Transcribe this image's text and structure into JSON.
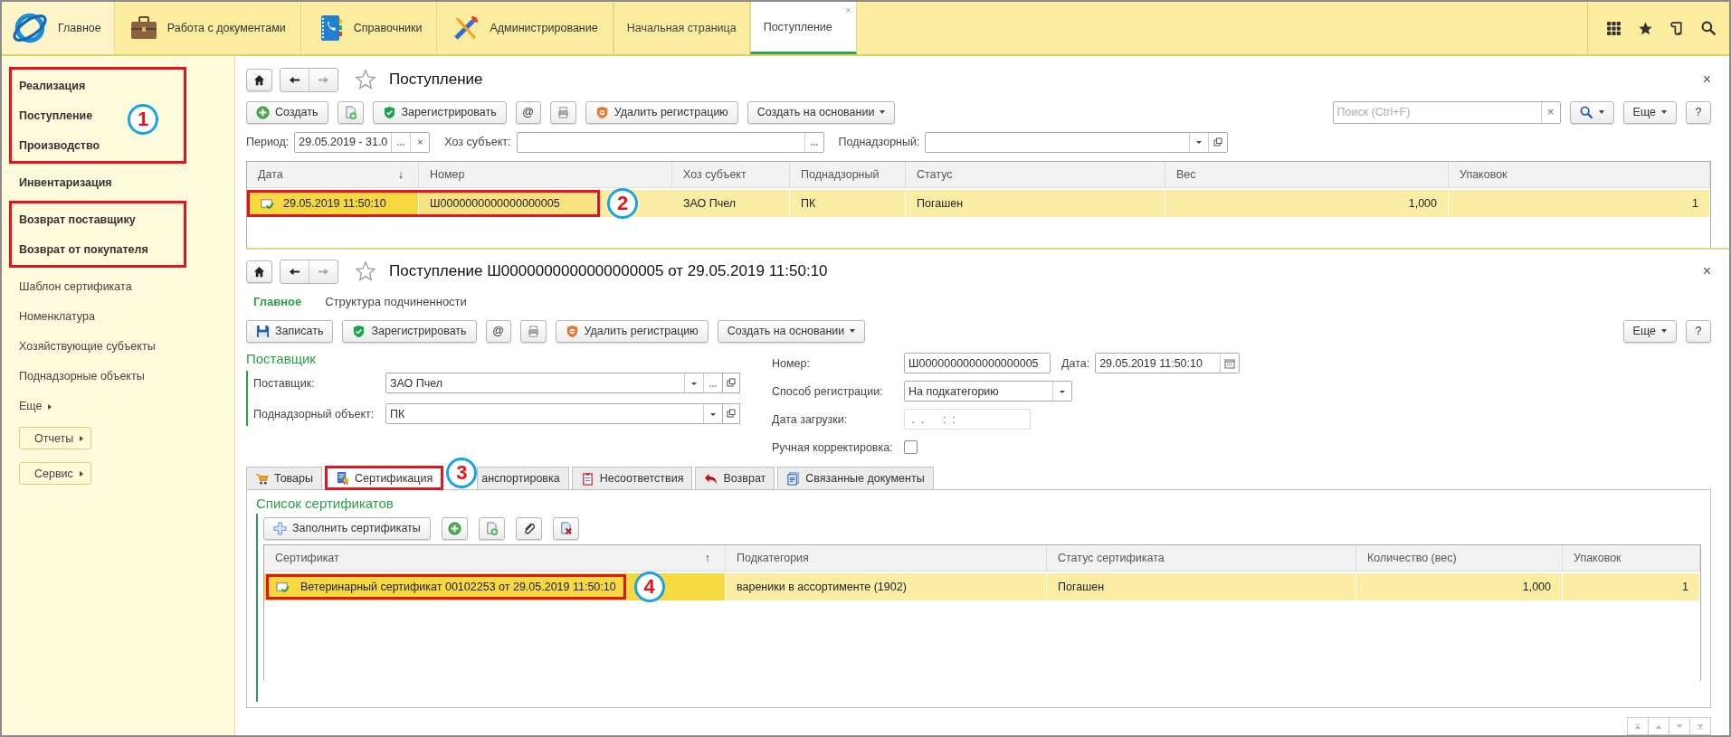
{
  "top_nav": {
    "sections": [
      {
        "label": "Главное",
        "kind": "logo",
        "selected": true
      },
      {
        "label": "Работа с документами",
        "kind": "briefcase",
        "selected": false
      },
      {
        "label": "Справочники",
        "kind": "book",
        "selected": false
      },
      {
        "label": "Администрирование",
        "kind": "tools",
        "selected": false
      }
    ],
    "open_tabs": [
      {
        "label": "Начальная страница",
        "selected": false,
        "closable": false
      },
      {
        "label": "Поступление",
        "selected": true,
        "closable": true
      }
    ],
    "close_glyph": "×"
  },
  "sidebar": {
    "groups": [
      {
        "outlined": true,
        "callout": "1",
        "items": [
          {
            "label": "Реализация",
            "kind": "section"
          },
          {
            "label": "Поступление",
            "kind": "section"
          },
          {
            "label": "Производство",
            "kind": "section"
          }
        ]
      },
      {
        "items": [
          {
            "label": "Инвентаризация",
            "kind": "section"
          }
        ]
      },
      {
        "outlined": true,
        "items": [
          {
            "label": "Возврат поставщику",
            "kind": "section"
          },
          {
            "label": "Возврат от покупателя",
            "kind": "section"
          }
        ]
      },
      {
        "items": [
          {
            "label": "Шаблон сертификата",
            "kind": "link"
          },
          {
            "label": "Номенклатура",
            "kind": "link"
          },
          {
            "label": "Хозяйствующие субъекты",
            "kind": "link"
          },
          {
            "label": "Поднадзорные объекты",
            "kind": "link"
          },
          {
            "label": "Еще",
            "kind": "more"
          },
          {
            "label": "Отчеты",
            "kind": "button"
          },
          {
            "label": "Сервис",
            "kind": "button"
          }
        ]
      }
    ]
  },
  "list_form": {
    "title": "Поступление",
    "close": "×",
    "toolbar": [
      {
        "label": "Создать",
        "kind": "create"
      },
      {
        "kind": "copy"
      },
      {
        "label": "Зарегистрировать",
        "kind": "register"
      },
      {
        "label": "@",
        "kind": "text"
      },
      {
        "kind": "print"
      },
      {
        "label": "Удалить регистрацию",
        "kind": "unregister"
      },
      {
        "label": "Создать на основании",
        "kind": "dropdown"
      }
    ],
    "search": {
      "placeholder": "Поиск (Ctrl+F)",
      "clear": "×"
    },
    "more": "Еще",
    "help": "?",
    "filters": [
      {
        "label": "Период:",
        "value": "29.05.2019 - 31.0",
        "kind": "period",
        "clear": "×"
      },
      {
        "label": "Хоз субъект:",
        "kind": "choice"
      },
      {
        "label": "Поднадзорный:",
        "kind": "select"
      }
    ],
    "table": {
      "columns": [
        {
          "label": "Дата",
          "sort": "↓"
        },
        {
          "label": "Номер"
        },
        {
          "label": "Хоз субъект"
        },
        {
          "label": "Поднадзорный"
        },
        {
          "label": "Статус"
        },
        {
          "label": "Вес",
          "numeric": true
        },
        {
          "label": "Упаковок",
          "numeric": true
        }
      ],
      "rows": [
        {
          "selected": true,
          "callout": "2",
          "cells": [
            "29.05.2019 11:50:10",
            "Ш0000000000000000005",
            "ЗАО Пчел",
            "ПК",
            "Погашен",
            "1,000",
            "1"
          ]
        }
      ]
    }
  },
  "doc_form": {
    "title": "Поступление Ш0000000000000000005 от 29.05.2019 11:50:10",
    "close": "×",
    "nav": [
      {
        "label": "Главное",
        "selected": true
      },
      {
        "label": "Структура подчиненности",
        "selected": false
      }
    ],
    "toolbar": [
      {
        "label": "Записать",
        "kind": "save"
      },
      {
        "label": "Зарегистрировать",
        "kind": "register"
      },
      {
        "label": "@",
        "kind": "text"
      },
      {
        "kind": "print"
      },
      {
        "label": "Удалить регистрацию",
        "kind": "unregister"
      },
      {
        "label": "Создать на основании",
        "kind": "dropdown"
      }
    ],
    "more": "Еще",
    "help": "?",
    "supplier_group": {
      "title": "Поставщик",
      "fields": [
        {
          "label": "Поставщик:",
          "value": "ЗАО Пчел",
          "kind": "full"
        },
        {
          "label": "Поднадзорный объект:",
          "value": "ПК",
          "kind": "short"
        }
      ]
    },
    "number": {
      "label": "Номер:",
      "value": "Ш0000000000000000005"
    },
    "date": {
      "label": "Дата:",
      "value": "29.05.2019 11:50:10"
    },
    "method": {
      "label": "Способ регистрации:",
      "value": "На подкатегорию"
    },
    "load_date": {
      "label": "Дата загрузки:",
      "value": " .  .      :  :"
    },
    "manual": {
      "label": "Ручная корректировка:",
      "checked": false
    },
    "tabs": [
      {
        "label": "Товары",
        "kind": "cart",
        "selected": false
      },
      {
        "label": "Сертификация",
        "kind": "cert",
        "selected": true,
        "callout": "3"
      },
      {
        "label": "анспортировка",
        "kind": "covered",
        "selected": false
      },
      {
        "label": "Несоответствия",
        "kind": "clipboard",
        "selected": false
      },
      {
        "label": "Возврат",
        "kind": "return",
        "selected": false
      },
      {
        "label": "Связанные документы",
        "kind": "docs",
        "selected": false
      }
    ],
    "cert_list": {
      "title": "Список сертификатов",
      "toolbar": [
        {
          "label": "Заполнить сертификаты",
          "kind": "fill"
        },
        {
          "kind": "add"
        },
        {
          "kind": "copy"
        },
        {
          "kind": "attach"
        },
        {
          "kind": "delete"
        }
      ],
      "table": {
        "columns": [
          {
            "label": "Сертификат",
            "sort": "↑"
          },
          {
            "label": "Подкатегория"
          },
          {
            "label": "Статус сертификата"
          },
          {
            "label": "Количество (вес)",
            "numeric": true
          },
          {
            "label": "Упаковок",
            "numeric": true
          }
        ],
        "rows": [
          {
            "selected": true,
            "callout": "4",
            "cells": [
              "Ветеринарный сертификат 00102253 от 29.05.2019 11:50:10",
              "вареники в ассортименте (1902)",
              "Погашен",
              "1,000",
              "1"
            ]
          }
        ]
      }
    }
  }
}
